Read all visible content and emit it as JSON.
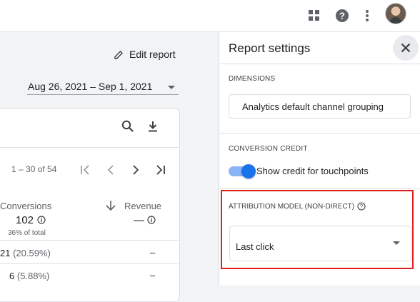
{
  "header": {
    "icons": [
      "apps-grid-icon",
      "help-icon",
      "more-vert-icon",
      "avatar"
    ]
  },
  "report": {
    "edit_label": "Edit report",
    "date_range": "Aug 26, 2021 – Sep 1, 2021",
    "pagination": "1 – 30 of 54",
    "columns": {
      "conversions": "Conversions",
      "revenue": "Revenue"
    },
    "totals": {
      "conversions": "102",
      "conversions_share": "36% of total",
      "revenue": "—"
    },
    "rows": [
      {
        "conversions": "21",
        "share": "(20.59%)",
        "revenue": "–"
      },
      {
        "conversions": "6",
        "share": "(5.88%)",
        "revenue": "–"
      }
    ]
  },
  "settings": {
    "title": "Report settings",
    "dimensions_label": "DIMENSIONS",
    "dimension_value": "Analytics default channel grouping",
    "conversion_credit_label": "CONVERSION CREDIT",
    "toggle_label": "Show credit for touchpoints",
    "toggle_on": true,
    "attribution_label": "ATTRIBUTION MODEL (NON-DIRECT)",
    "attribution_value": "Last click"
  },
  "colors": {
    "accent": "#1a73e8",
    "highlight": "#e0201e"
  }
}
